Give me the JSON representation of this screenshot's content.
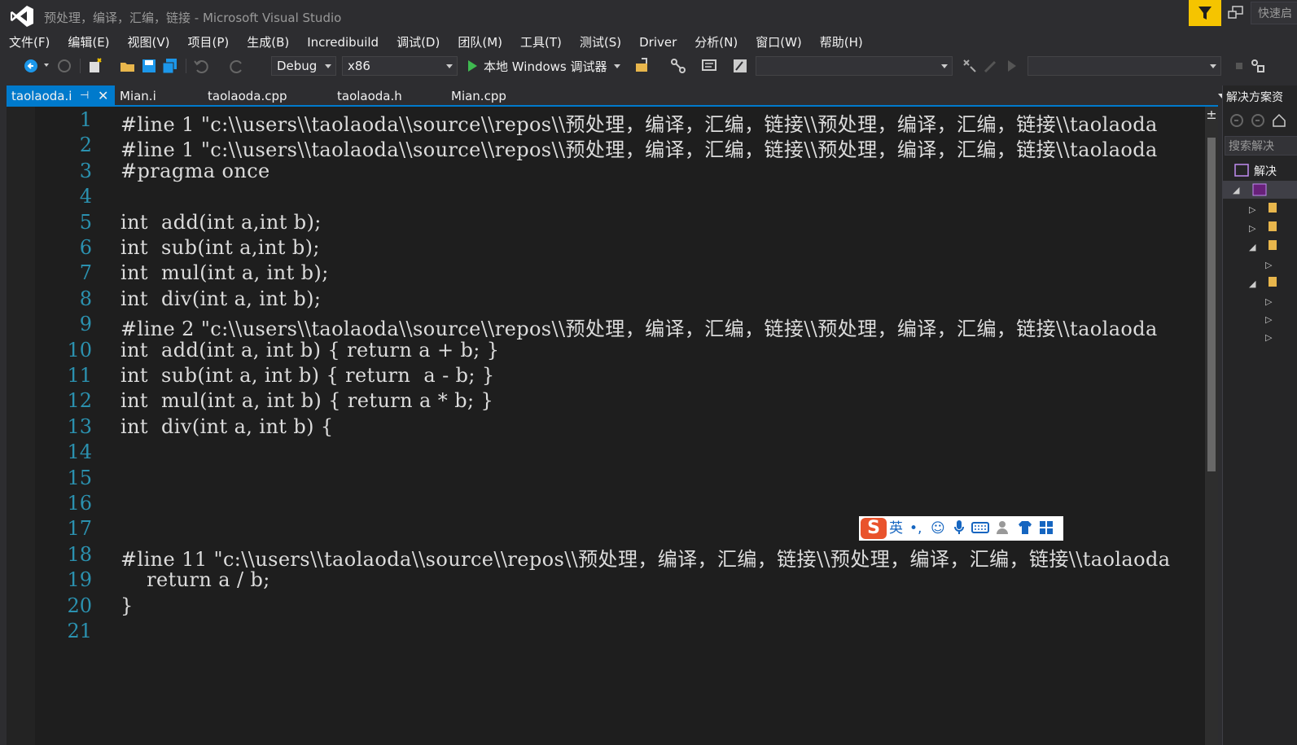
{
  "window": {
    "title": "预处理，编译，汇编，链接 - Microsoft Visual Studio",
    "quick_launch": "快速启"
  },
  "menu": [
    "文件(F)",
    "编辑(E)",
    "视图(V)",
    "项目(P)",
    "生成(B)",
    "Incredibuild",
    "调试(D)",
    "团队(M)",
    "工具(T)",
    "测试(S)",
    "Driver",
    "分析(N)",
    "窗口(W)",
    "帮助(H)"
  ],
  "toolbar": {
    "config": "Debug",
    "platform": "x86",
    "run_label": "本地 Windows 调试器"
  },
  "tabs": {
    "active": "taolaoda.i",
    "others": [
      "Mian.i",
      "taolaoda.cpp",
      "taolaoda.h",
      "Mian.cpp"
    ]
  },
  "editor": {
    "line_numbers": [
      "1",
      "2",
      "3",
      "4",
      "5",
      "6",
      "7",
      "8",
      "9",
      "10",
      "11",
      "12",
      "13",
      "14",
      "15",
      "16",
      "17",
      "18",
      "19",
      "20",
      "21"
    ],
    "lines": [
      "#line 1 \"c:\\\\users\\\\taolaoda\\\\source\\\\repos\\\\预处理，编译，汇编，链接\\\\预处理，编译，汇编，链接\\\\taolaoda",
      "#line 1 \"c:\\\\users\\\\taolaoda\\\\source\\\\repos\\\\预处理，编译，汇编，链接\\\\预处理，编译，汇编，链接\\\\taolaoda",
      "#pragma once",
      "",
      "int  add(int a,int b);",
      "int  sub(int a,int b);",
      "int  mul(int a, int b);",
      "int  div(int a, int b);",
      "#line 2 \"c:\\\\users\\\\taolaoda\\\\source\\\\repos\\\\预处理，编译，汇编，链接\\\\预处理，编译，汇编，链接\\\\taolaoda",
      "int  add(int a, int b) { return a + b; }",
      "int  sub(int a, int b) { return  a - b; }",
      "int  mul(int a, int b) { return a * b; }",
      "int  div(int a, int b) {",
      "",
      "",
      "",
      "",
      "#line 11 \"c:\\\\users\\\\taolaoda\\\\source\\\\repos\\\\预处理，编译，汇编，链接\\\\预处理，编译，汇编，链接\\\\taolaoda",
      "    return a / b;",
      "}",
      ""
    ]
  },
  "ime": {
    "lang": "英",
    "punct": "•,"
  },
  "solution_explorer": {
    "title": "解决方案资",
    "search": "搜索解决",
    "root": "解决"
  }
}
